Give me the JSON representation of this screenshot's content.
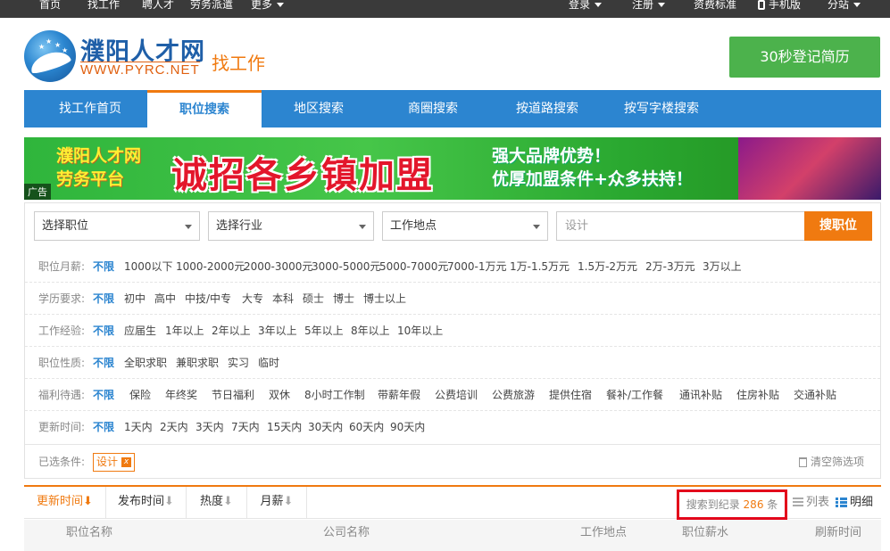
{
  "topbar": {
    "home": "首页",
    "find_job": "找工作",
    "hire": "聘人才",
    "labor": "劳务派遣",
    "more": "更多",
    "login": "登录",
    "register": "注册",
    "fees": "资费标准",
    "mobile": "手机版",
    "branch": "分站"
  },
  "header": {
    "logo_title": "濮阳人才网",
    "logo_url": "WWW.PYRC.NET",
    "section": "找工作",
    "register_button": "30秒登记简历"
  },
  "nav": {
    "items": [
      "找工作首页",
      "职位搜索",
      "地区搜索",
      "商圈搜索",
      "按道路搜索",
      "按写字楼搜索"
    ],
    "active": "职位搜索"
  },
  "banner": {
    "left_line1": "濮阳人才网",
    "left_line2": "劳务平台",
    "main": "诚招各乡镇加盟",
    "right_line1": "强大品牌优势！",
    "right_line2": "优厚加盟条件+众多扶持！",
    "ad_tag": "广告"
  },
  "search": {
    "position_select": "选择职位",
    "industry_select": "选择行业",
    "location_select": "工作地点",
    "keyword_value": "设计",
    "button": "搜职位"
  },
  "filters": [
    {
      "label": "职位月薪:",
      "options": [
        "不限",
        "1000以下",
        "1000-2000元",
        "2000-3000元",
        "3000-5000元",
        "5000-7000元",
        "7000-1万元",
        "1万-1.5万元",
        "1.5万-2万元",
        "2万-3万元",
        "3万以上"
      ]
    },
    {
      "label": "学历要求:",
      "options": [
        "不限",
        "初中",
        "高中",
        "中技/中专",
        "大专",
        "本科",
        "硕士",
        "博士",
        "博士以上"
      ]
    },
    {
      "label": "工作经验:",
      "options": [
        "不限",
        "应届生",
        "1年以上",
        "2年以上",
        "3年以上",
        "5年以上",
        "8年以上",
        "10年以上"
      ]
    },
    {
      "label": "职位性质:",
      "options": [
        "不限",
        "全职求职",
        "兼职求职",
        "实习",
        "临时"
      ]
    },
    {
      "label": "福利待遇:",
      "options": [
        "不限",
        "保险",
        "年终奖",
        "节日福利",
        "双休",
        "8小时工作制",
        "带薪年假",
        "公费培训",
        "公费旅游",
        "提供住宿",
        "餐补/工作餐",
        "通讯补贴",
        "住房补贴",
        "交通补贴"
      ]
    },
    {
      "label": "更新时间:",
      "options": [
        "不限",
        "1天内",
        "2天内",
        "3天内",
        "7天内",
        "15天内",
        "30天内",
        "60天内",
        "90天内"
      ]
    }
  ],
  "chosen": {
    "label": "已选条件:",
    "tag": "设计",
    "tag_close": "x",
    "clear": "清空筛选项"
  },
  "sort": {
    "items": [
      "更新时间",
      "发布时间",
      "热度",
      "月薪"
    ],
    "result_prefix": "搜索到纪录",
    "result_count": "286",
    "result_suffix": "条",
    "view_list": "列表",
    "view_detail": "明细"
  },
  "table_header": {
    "position": "职位名称",
    "company": "公司名称",
    "location": "工作地点",
    "salary": "职位薪水",
    "refresh": "刷新时间"
  },
  "colors": {
    "accent_orange": "#f07a10",
    "nav_blue": "#2c85d0",
    "register_green": "#4cb24c",
    "highlight_red": "#e3061b"
  }
}
